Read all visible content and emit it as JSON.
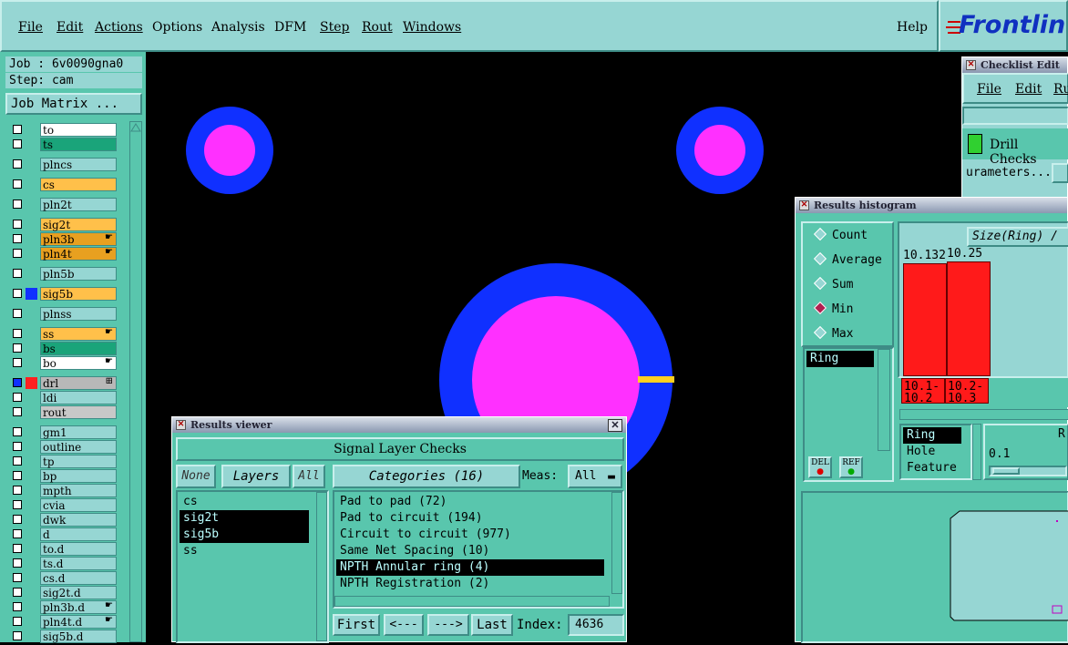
{
  "menubar": {
    "items": [
      "File",
      "Edit",
      "Actions",
      "Options",
      "Analysis",
      "DFM",
      "Step",
      "Rout",
      "Windows"
    ],
    "help": "Help",
    "logo": "Frontlin"
  },
  "job": {
    "job_line": "Job : 6v0090gna0",
    "step_line": "Step: cam",
    "matrix_btn": "Job Matrix ..."
  },
  "layers": [
    {
      "name": "to",
      "color": "#ffffff",
      "sw": ""
    },
    {
      "name": "ts",
      "color": "#1aa47a",
      "sw": ""
    },
    {
      "name": "plncs",
      "color": "#96d6d3",
      "sw": ""
    },
    {
      "name": "cs",
      "color": "#ffc04a",
      "sw": ""
    },
    {
      "name": "pln2t",
      "color": "#96d6d3",
      "sw": ""
    },
    {
      "name": "sig2t",
      "color": "#ffc04a",
      "sw": ""
    },
    {
      "name": "pln3b",
      "color": "#e8a020",
      "sw": "",
      "mk": "☛"
    },
    {
      "name": "pln4t",
      "color": "#e8a020",
      "sw": "",
      "mk": "☛"
    },
    {
      "name": "pln5b",
      "color": "#96d6d3",
      "sw": ""
    },
    {
      "name": "sig5b",
      "color": "#ffc04a",
      "sw": "#1030ff"
    },
    {
      "name": "plnss",
      "color": "#96d6d3",
      "sw": ""
    },
    {
      "name": "ss",
      "color": "#ffc04a",
      "sw": "",
      "mk": "☛"
    },
    {
      "name": "bs",
      "color": "#1aa47a",
      "sw": ""
    },
    {
      "name": "bo",
      "color": "#ffffff",
      "sw": "",
      "mk": "☛"
    },
    {
      "name": "drl",
      "color": "#b8b8b8",
      "sw": "#ff2020",
      "mk": "⊞"
    },
    {
      "name": "ldi",
      "color": "#96d6d3",
      "sw": ""
    },
    {
      "name": "rout",
      "color": "#c8c8c8",
      "sw": ""
    },
    {
      "name": "gm1",
      "color": "#96d6d3",
      "sw": ""
    },
    {
      "name": "outline",
      "color": "#96d6d3",
      "sw": ""
    },
    {
      "name": "tp",
      "color": "#96d6d3",
      "sw": ""
    },
    {
      "name": "bp",
      "color": "#96d6d3",
      "sw": ""
    },
    {
      "name": "mpth",
      "color": "#96d6d3",
      "sw": ""
    },
    {
      "name": "cvia",
      "color": "#96d6d3",
      "sw": ""
    },
    {
      "name": "dwk",
      "color": "#96d6d3",
      "sw": ""
    },
    {
      "name": "d",
      "color": "#96d6d3",
      "sw": ""
    },
    {
      "name": "to.d",
      "color": "#96d6d3",
      "sw": ""
    },
    {
      "name": "ts.d",
      "color": "#96d6d3",
      "sw": ""
    },
    {
      "name": "cs.d",
      "color": "#96d6d3",
      "sw": ""
    },
    {
      "name": "sig2t.d",
      "color": "#96d6d3",
      "sw": ""
    },
    {
      "name": "pln3b.d",
      "color": "#96d6d3",
      "sw": "",
      "mk": "☛"
    },
    {
      "name": "pln4t.d",
      "color": "#96d6d3",
      "sw": "",
      "mk": "☛"
    },
    {
      "name": "sig5b.d",
      "color": "#96d6d3",
      "sw": ""
    }
  ],
  "checklist": {
    "title": "Checklist Edit",
    "menu": [
      "File",
      "Edit",
      "Ru"
    ],
    "item": "Drill Checks",
    "params": "urameters..."
  },
  "results_viewer": {
    "title": "Results viewer",
    "header": "Signal Layer Checks",
    "none_btn": "None",
    "layers_btn": "Layers",
    "all_btn": "All",
    "categories_btn": "Categories (16)",
    "meas_label": "Meas:",
    "meas_value": "All",
    "layer_list": [
      "cs",
      "sig2t",
      "sig5b",
      "ss"
    ],
    "category_list": [
      "Pad to pad (72)",
      "Pad to circuit (194)",
      "Circuit to circuit (977)",
      "Same Net Spacing (10)",
      "NPTH Annular ring (4)",
      "NPTH Registration (2)"
    ],
    "first_btn": "First",
    "prev_btn": "<---",
    "next_btn": "--->",
    "last_btn": "Last",
    "index_label": "Index:",
    "index_value": "4636"
  },
  "histogram": {
    "title": "Results histogram",
    "modes": [
      "Count",
      "Average",
      "Sum",
      "Min",
      "Max"
    ],
    "selected_mode": "Min",
    "list_item": "Ring",
    "header": "Size(Ring) /",
    "bars": [
      {
        "value_label": "10.132",
        "range": "10.1-\n10.2"
      },
      {
        "value_label": "10.25",
        "range": "10.2-\n10.3"
      }
    ],
    "del_btn": "DEL",
    "ref_btn": "REF",
    "filter_list": [
      "Ring",
      "Hole",
      "Feature"
    ],
    "right_label": "R",
    "slider_value": "0.1"
  },
  "colors": {
    "accent": "#96d6d3",
    "panel": "#59c6ad",
    "pad_outer": "#1030ff",
    "pad_inner": "#ff30ff",
    "bar": "#ff1a1a"
  }
}
